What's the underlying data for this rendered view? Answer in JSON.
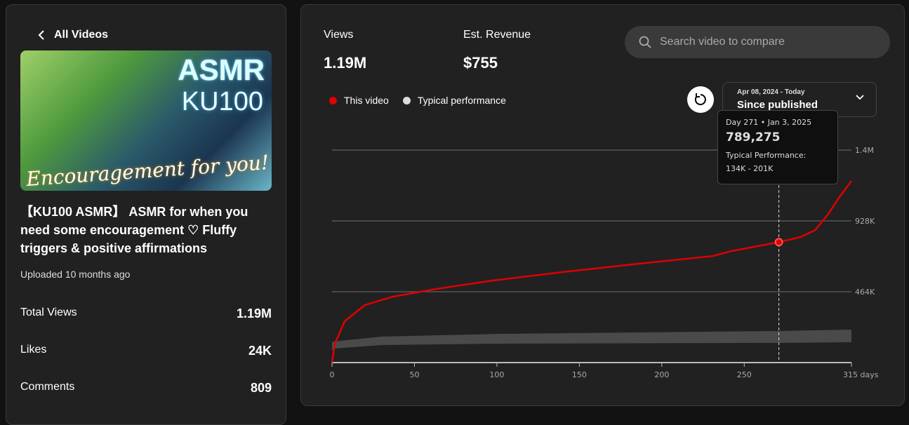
{
  "left": {
    "back_label": "All Videos",
    "thumbnail": {
      "logo_text": [
        "ASMR",
        "KU100",
        "Encouragement for you!"
      ]
    },
    "title": "【KU100 ASMR】 ASMR for when you need some encouragement ♡ Fluffy triggers & positive affirmations",
    "uploaded": "Uploaded 10 months ago",
    "stats": [
      {
        "label": "Total Views",
        "value": "1.19M"
      },
      {
        "label": "Likes",
        "value": "24K"
      },
      {
        "label": "Comments",
        "value": "809"
      }
    ]
  },
  "metrics": [
    {
      "label": "Views",
      "value": "1.19M"
    },
    {
      "label": "Est. Revenue",
      "value": "$755"
    }
  ],
  "search": {
    "placeholder": "Search video to compare"
  },
  "legend": {
    "this_video": "This video",
    "typical": "Typical performance"
  },
  "range": {
    "dates": "Apr 08, 2024 - Today",
    "label": "Since published"
  },
  "tooltip": {
    "date": "Day 271 • Jan 3, 2025",
    "value": "789,275",
    "typical_label": "Typical Performance:",
    "typical_range": "134K - 201K"
  },
  "chart_data": {
    "type": "line",
    "xlabel": "days",
    "xlim": [
      0,
      315
    ],
    "ylim": [
      0,
      1392
    ],
    "x_ticks": [
      {
        "v": 0,
        "label": "0"
      },
      {
        "v": 50,
        "label": "50"
      },
      {
        "v": 100,
        "label": "100"
      },
      {
        "v": 150,
        "label": "150"
      },
      {
        "v": 200,
        "label": "200"
      },
      {
        "v": 250,
        "label": "250"
      },
      {
        "v": 315,
        "label": "315 days"
      }
    ],
    "y_ticks": [
      {
        "v": 464,
        "label": "464K"
      },
      {
        "v": 928,
        "label": "928K"
      },
      {
        "v": 1392,
        "label": "1.4M"
      }
    ],
    "colors": {
      "this": "#e00000",
      "band": "#4a4a4a"
    },
    "this_video": [
      [
        0,
        0
      ],
      [
        1.7,
        124
      ],
      [
        7.7,
        271
      ],
      [
        20,
        377
      ],
      [
        37,
        432
      ],
      [
        63,
        482
      ],
      [
        97,
        537
      ],
      [
        140,
        593
      ],
      [
        182,
        643
      ],
      [
        231,
        698
      ],
      [
        242,
        730
      ],
      [
        271,
        789
      ],
      [
        284,
        822
      ],
      [
        293,
        868
      ],
      [
        301,
        974
      ],
      [
        308,
        1089
      ],
      [
        315,
        1190
      ]
    ],
    "typical_band": [
      [
        0,
        78,
        133
      ],
      [
        1,
        92,
        138
      ],
      [
        30,
        115,
        170
      ],
      [
        100,
        124,
        188
      ],
      [
        271,
        129,
        207
      ],
      [
        315,
        133,
        216
      ]
    ],
    "highlight_day": 271
  }
}
